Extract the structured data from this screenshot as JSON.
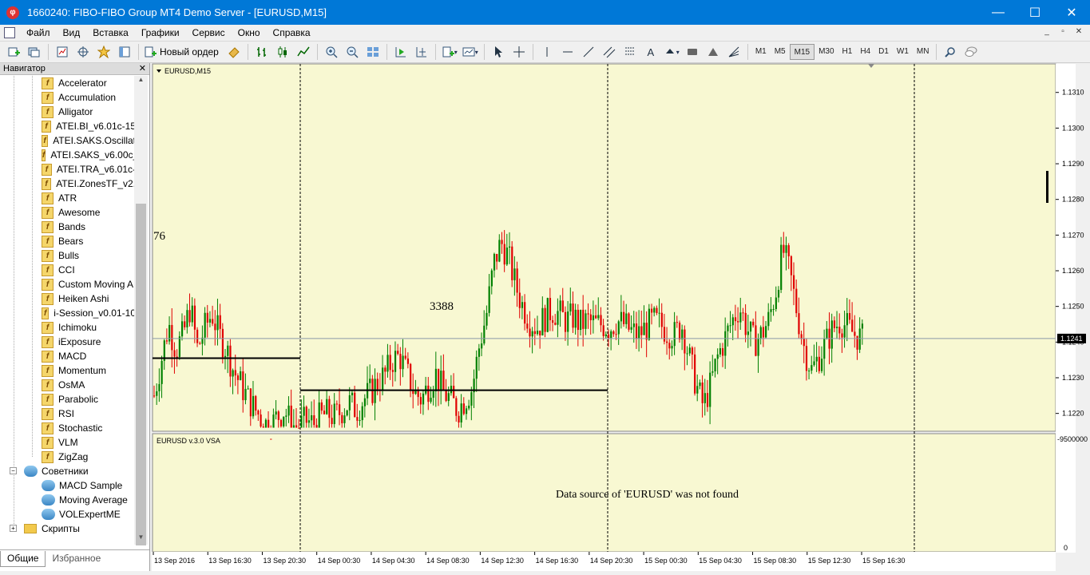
{
  "window": {
    "app_icon": "fibo-app-icon",
    "title": "1660240: FIBO-FIBO Group MT4 Demo Server - [EURUSD,M15]",
    "buttons": [
      "—",
      "☐",
      "✕"
    ]
  },
  "menu": {
    "items": [
      "Файл",
      "Вид",
      "Вставка",
      "Графики",
      "Сервис",
      "Окно",
      "Справка"
    ],
    "mdi_buttons": [
      "_",
      "▫",
      "✕"
    ]
  },
  "toolbar": {
    "new_order_label": "Новый ордер",
    "timeframes": [
      "M1",
      "M5",
      "M15",
      "M30",
      "H1",
      "H4",
      "D1",
      "W1",
      "MN"
    ],
    "active_timeframe": "M15",
    "text_tool": "A"
  },
  "navigator": {
    "header": "Навигатор",
    "close": "✕",
    "indicators": [
      "Accelerator",
      "Accumulation",
      "Alligator",
      "ATEI.BI_v6.01c-15",
      "ATEI.SAKS.Oscillat",
      "ATEI.SAKS_v6.00c_",
      "ATEI.TRA_v6.01c-",
      "ATEI.ZonesTF_v2.",
      "ATR",
      "Awesome",
      "Bands",
      "Bears",
      "Bulls",
      "CCI",
      "Custom Moving A",
      "Heiken Ashi",
      "i-Session_v0.01-10",
      "Ichimoku",
      "iExposure",
      "MACD",
      "Momentum",
      "OsMA",
      "Parabolic",
      "RSI",
      "Stochastic",
      "VLM",
      "ZigZag"
    ],
    "experts_folder": "Советники",
    "experts": [
      "MACD Sample",
      "Moving Average",
      "VOLExpertME"
    ],
    "scripts_folder": "Скрипты",
    "tabs": [
      "Общие",
      "Избранное"
    ]
  },
  "chart": {
    "symbol_label": "EURUSD,M15",
    "indicator_label": "EURUSD v.3.0 VSA",
    "message": "Data source of 'EURUSD' was not found",
    "text_objects": [
      "76",
      "3388"
    ],
    "indicator_scale_top": "-9500000",
    "indicator_scale_bottom": "0",
    "current_price": "1.1241",
    "colors": {
      "background": "#f8f8d2",
      "bull": "#008000",
      "bear": "#e00000"
    }
  },
  "chart_data": {
    "type": "candlestick",
    "y_ticks": [
      "1.1310",
      "1.1300",
      "1.1290",
      "1.1280",
      "1.1270",
      "1.1260",
      "1.1250",
      "1.1240",
      "1.1230",
      "1.1220"
    ],
    "ylim": [
      1.1215,
      1.1318
    ],
    "x_ticks": [
      "13 Sep 2016",
      "13 Sep 16:30",
      "13 Sep 20:30",
      "14 Sep 00:30",
      "14 Sep 04:30",
      "14 Sep 08:30",
      "14 Sep 12:30",
      "14 Sep 16:30",
      "14 Sep 20:30",
      "15 Sep 00:30",
      "15 Sep 04:30",
      "15 Sep 08:30",
      "15 Sep 12:30",
      "15 Sep 16:30"
    ],
    "current_price": 1.1241,
    "session_lines": [
      1.12355,
      1.12265
    ],
    "close_path": [
      1.1225,
      1.1235,
      1.1245,
      1.1238,
      1.1242,
      1.125,
      1.1238,
      1.1244,
      1.1248,
      1.1242,
      1.1238,
      1.1232,
      1.1228,
      1.1224,
      1.1221,
      1.1218,
      1.1216,
      1.1219,
      1.1221,
      1.1217,
      1.1216,
      1.1218,
      1.1217,
      1.1219,
      1.122,
      1.1219,
      1.1221,
      1.1223,
      1.1221,
      1.1224,
      1.1226,
      1.1229,
      1.1231,
      1.1235,
      1.1236,
      1.1231,
      1.1226,
      1.1224,
      1.1228,
      1.1231,
      1.1226,
      1.1224,
      1.1221,
      1.1224,
      1.1227,
      1.1239,
      1.1248,
      1.1262,
      1.1268,
      1.1264,
      1.1256,
      1.125,
      1.1246,
      1.1244,
      1.1247,
      1.1249,
      1.1248,
      1.1246,
      1.1247,
      1.1245,
      1.1246,
      1.1245,
      1.1245,
      1.1244,
      1.1246,
      1.1245,
      1.1243,
      1.1242,
      1.1244,
      1.1246,
      1.1245,
      1.1243,
      1.1242,
      1.1245,
      1.1236,
      1.1228,
      1.1222,
      1.1228,
      1.1236,
      1.1241,
      1.1246,
      1.125,
      1.1244,
      1.124,
      1.1242,
      1.1246,
      1.1254,
      1.1266,
      1.1259,
      1.1248,
      1.1238,
      1.1232,
      1.1236,
      1.124,
      1.1244,
      1.1246,
      1.1244,
      1.1242,
      1.1241
    ]
  }
}
